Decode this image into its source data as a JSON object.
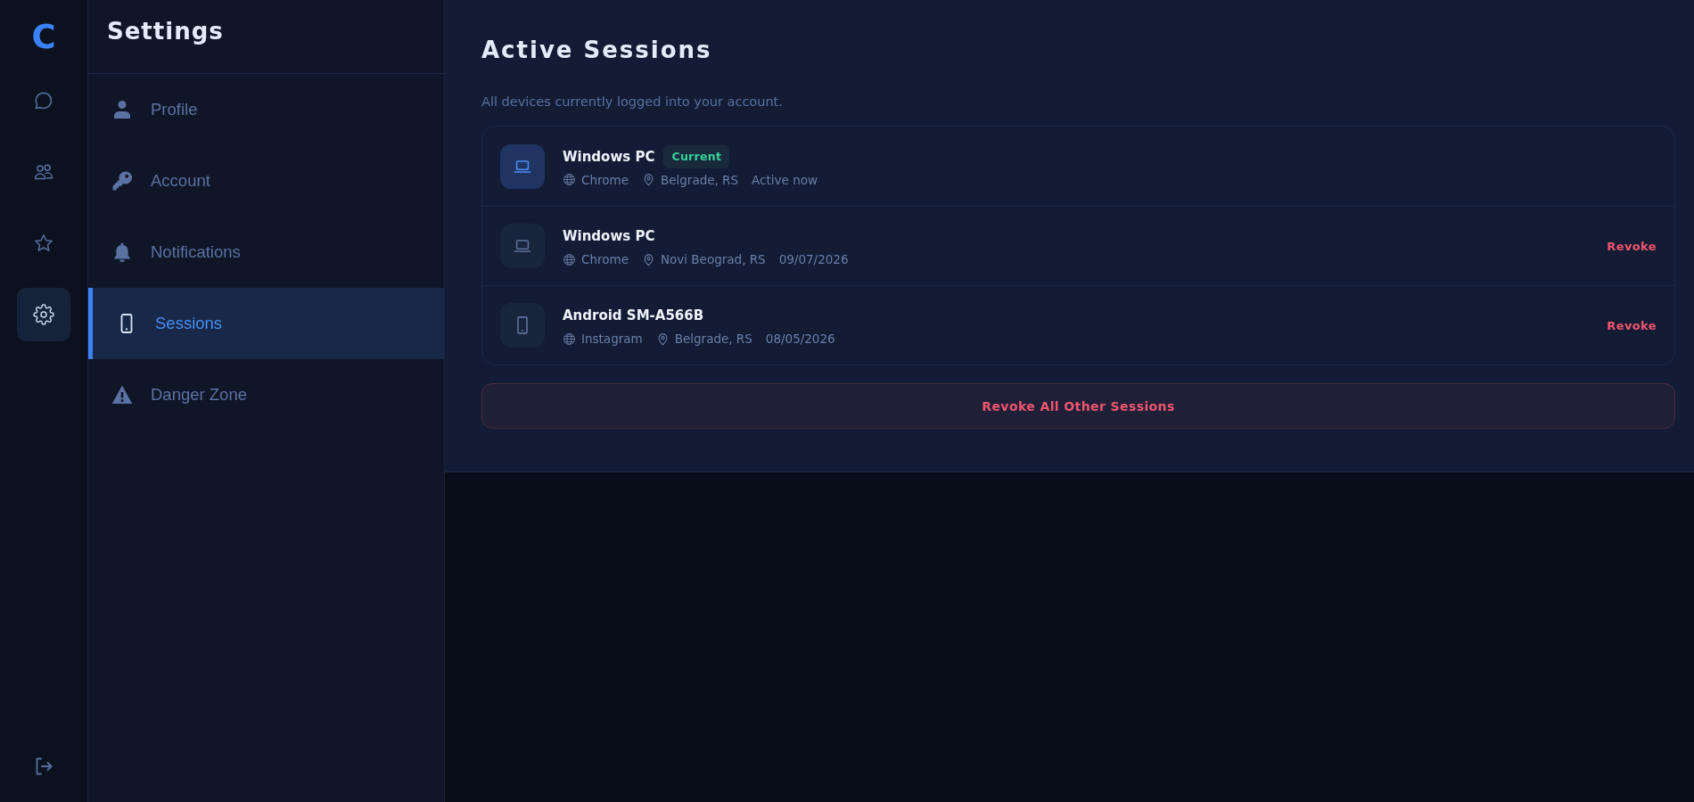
{
  "rail": {
    "logo": "C",
    "items": [
      {
        "kind": "chat",
        "selected": false
      },
      {
        "kind": "people",
        "selected": false
      },
      {
        "kind": "star",
        "selected": false
      },
      {
        "kind": "gear",
        "selected": true
      }
    ]
  },
  "sidebar": {
    "title": "Settings",
    "items": [
      {
        "label": "Profile",
        "kind": "user",
        "selected": false
      },
      {
        "label": "Account",
        "kind": "key",
        "selected": false
      },
      {
        "label": "Notifications",
        "kind": "bell",
        "selected": false
      },
      {
        "label": "Sessions",
        "kind": "phone",
        "selected": true
      },
      {
        "label": "Danger Zone",
        "kind": "warning",
        "selected": false
      }
    ]
  },
  "main": {
    "title": "Active Sessions",
    "subtitle": "All devices currently logged into your account.",
    "sessions": [
      {
        "device": "Windows PC",
        "kind": "laptop",
        "current": true,
        "badge": "Current",
        "app": "Chrome",
        "location": "Belgrade, RS",
        "time": "Active now"
      },
      {
        "device": "Windows PC",
        "kind": "laptop",
        "current": false,
        "app": "Chrome",
        "location": "Novi Beograd, RS",
        "time": "09/07/2026",
        "action": "Revoke"
      },
      {
        "device": "Android SM-A566B",
        "kind": "phone",
        "current": false,
        "app": "Instagram",
        "location": "Belgrade, RS",
        "time": "08/05/2026",
        "action": "Revoke"
      }
    ],
    "revoke_all": "Revoke All Other Sessions"
  }
}
